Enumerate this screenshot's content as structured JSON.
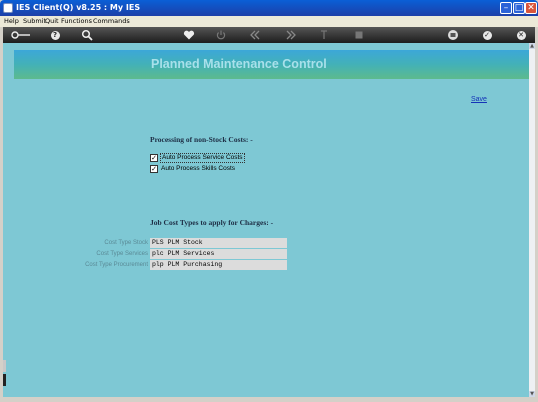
{
  "window": {
    "title": "IES Client(Q) v8.25 : My IES",
    "min": "–",
    "max": "□",
    "close": "✕"
  },
  "menu": [
    {
      "label": "Help"
    },
    {
      "label": "Submit"
    },
    {
      "label": "Quit"
    },
    {
      "label": "Functions"
    },
    {
      "label": "Commands"
    }
  ],
  "toolbar": {
    "icons": [
      "key-icon",
      "help-icon",
      "search-icon",
      "heart-icon",
      "power-icon",
      "rewind-icon",
      "fast-forward-icon",
      "text-cursor-icon",
      "stop-icon",
      "print-icon",
      "check-icon",
      "close-icon"
    ],
    "help": "?",
    "check": "✓",
    "close": "✕"
  },
  "page": {
    "title": "Planned Maintenance Control",
    "save_label": "Save",
    "section1_heading": "Processing of non-Stock Costs: -",
    "checkbox1_label": "Auto Process Service Costs",
    "checkbox1_checked": true,
    "checkbox2_label": "Auto Process Skills Costs",
    "checkbox2_checked": true,
    "section2_heading": "Job Cost Types to apply for Charges: -",
    "cost_types": [
      {
        "label": "Cost Type Stock",
        "value": "PLS PLM Stock"
      },
      {
        "label": "Cost Type Services",
        "value": "plc PLM Services"
      },
      {
        "label": "Cost Type Procurement",
        "value": "plp PLM Purchasing"
      }
    ]
  },
  "colors": {
    "content_bg": "#7ec8d4",
    "title_color": "#a8e0ea",
    "link_color": "#1533b8"
  }
}
